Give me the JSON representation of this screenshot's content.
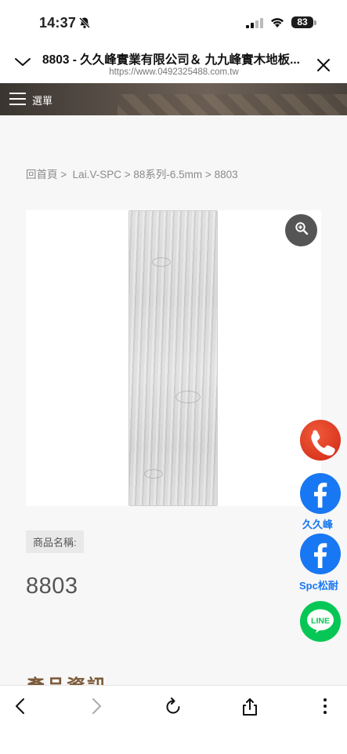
{
  "status_bar": {
    "time": "14:37",
    "battery": "83",
    "icons": [
      "bell-slash-icon",
      "signal-icon",
      "wifi-icon",
      "battery-icon"
    ]
  },
  "browser": {
    "page_title": "8803 - 久久峰實業有限公司＆ 九九峰實木地板...",
    "url": "https://www.0492325488.com.tw",
    "icons": [
      "chevron-down-icon",
      "close-icon"
    ]
  },
  "site_header": {
    "menu_label": "選單",
    "icons": [
      "hamburger-icon"
    ]
  },
  "breadcrumb": {
    "items": [
      "回首頁",
      "Lai.V-SPC",
      "88系列-6.5mm",
      "8803"
    ],
    "separator": ">"
  },
  "product": {
    "name_label": "商品名稱:",
    "name": "8803",
    "section_title": "產品資訊",
    "zoom_icon": "zoom-in-icon"
  },
  "floating_buttons": {
    "phone": {
      "icon": "phone-icon",
      "color": "#e03a1e"
    },
    "facebook_1": {
      "icon": "facebook-icon",
      "caption": "久久峰",
      "color": "#1877f2"
    },
    "facebook_2": {
      "icon": "facebook-icon",
      "caption": "Spc松耐",
      "color": "#1877f2"
    },
    "line": {
      "icon": "line-icon",
      "label": "LINE",
      "color": "#06c755"
    }
  },
  "toolbar": {
    "icons": [
      "back-icon",
      "forward-icon",
      "reload-icon",
      "share-icon",
      "more-icon"
    ]
  }
}
